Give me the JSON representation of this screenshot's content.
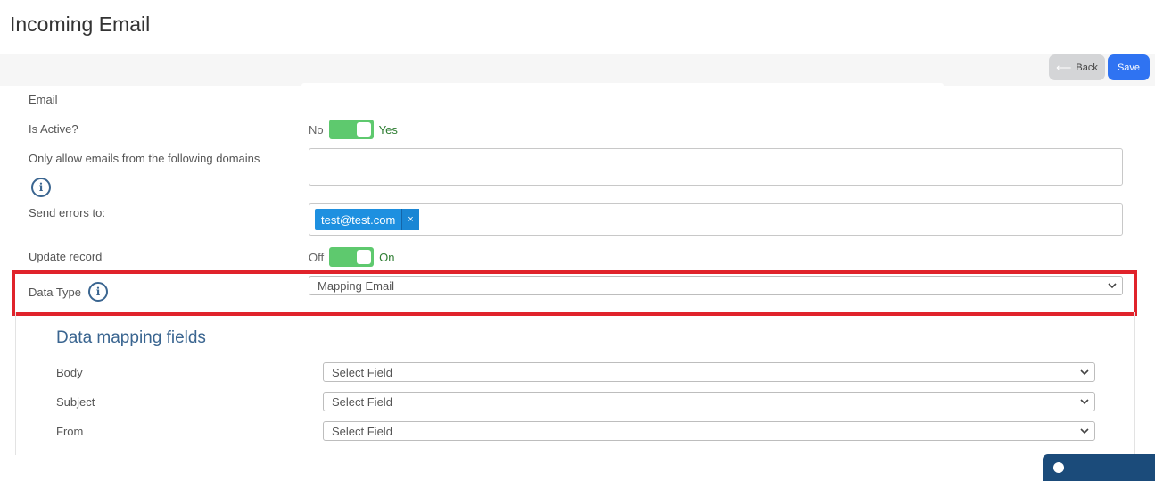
{
  "page": {
    "title": "Incoming Email"
  },
  "toolbar": {
    "back_label": "Back",
    "save_label": "Save"
  },
  "form": {
    "email_label": "Email",
    "is_active": {
      "label": "Is Active?",
      "off_label": "No",
      "on_label": "Yes",
      "value": true
    },
    "domains": {
      "label": "Only allow emails from the following domains",
      "value": ""
    },
    "send_errors": {
      "label": "Send errors to:",
      "tags": [
        "test@test.com"
      ],
      "remove_glyph": "×"
    },
    "update_record": {
      "label": "Update record",
      "off_label": "Off",
      "on_label": "On",
      "value": true
    },
    "data_type": {
      "label": "Data Type",
      "value": "Mapping Email"
    }
  },
  "mapping": {
    "title": "Data mapping fields",
    "fields": [
      {
        "label": "Body",
        "value": "Select Field"
      },
      {
        "label": "Subject",
        "value": "Select Field"
      },
      {
        "label": "From",
        "value": "Select Field"
      }
    ]
  },
  "colors": {
    "accent": "#2f73f2",
    "toggle_on": "#5ec96e",
    "tag": "#1e90e0",
    "highlight": "#e0232b",
    "heading": "#3a6590"
  },
  "icons": {
    "info": "info-icon",
    "back_arrow": "arrow-left-icon",
    "chevron": "chevron-down-icon"
  }
}
